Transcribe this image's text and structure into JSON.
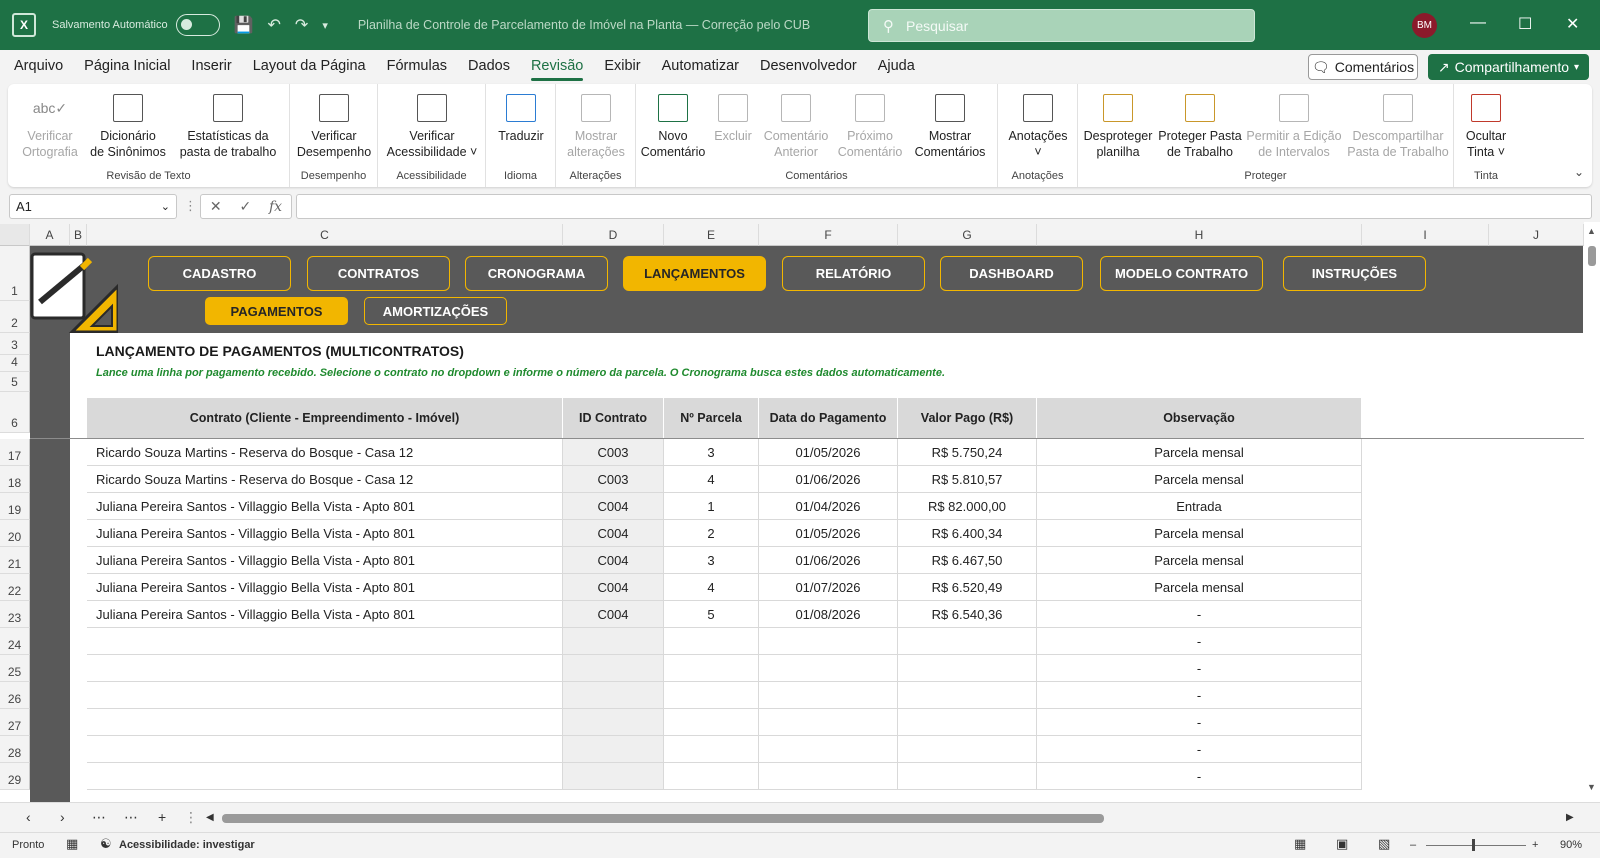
{
  "titlebar": {
    "app_icon": "excel-app-icon",
    "autosave_label": "Salvamento Automático",
    "document_title": "Planilha de Controle de Parcelamento de Imóvel na Planta — Correção pelo CUB",
    "search_placeholder": "Pesquisar",
    "avatar_initials": "BM",
    "color": "#1e7145"
  },
  "menu": {
    "items": [
      "Arquivo",
      "Página Inicial",
      "Inserir",
      "Layout da Página",
      "Fórmulas",
      "Dados",
      "Revisão",
      "Exibir",
      "Automatizar",
      "Desenvolvedor",
      "Ajuda"
    ],
    "active": "Revisão",
    "comments_label": "Comentários",
    "share_label": "Compartilhamento"
  },
  "ribbon": {
    "groups": [
      {
        "label": "Revisão de Texto",
        "buttons": [
          {
            "l1": "Verificar",
            "l2": "Ortografia",
            "disabled": true
          },
          {
            "l1": "Dicionário",
            "l2": "de Sinônimos",
            "disabled": false
          },
          {
            "l1": "Estatísticas da",
            "l2": "pasta de trabalho",
            "disabled": false
          }
        ]
      },
      {
        "label": "Desempenho",
        "buttons": [
          {
            "l1": "Verificar",
            "l2": "Desempenho",
            "disabled": false
          }
        ]
      },
      {
        "label": "Acessibilidade",
        "buttons": [
          {
            "l1": "Verificar",
            "l2": "Acessibilidade ˅",
            "disabled": false
          }
        ]
      },
      {
        "label": "Idioma",
        "buttons": [
          {
            "l1": "Traduzir",
            "l2": "",
            "disabled": false
          }
        ]
      },
      {
        "label": "Alterações",
        "buttons": [
          {
            "l1": "Mostrar",
            "l2": "alterações",
            "disabled": true
          }
        ]
      },
      {
        "label": "Comentários",
        "buttons": [
          {
            "l1": "Novo",
            "l2": "Comentário",
            "disabled": false
          },
          {
            "l1": "Excluir",
            "l2": "",
            "disabled": true
          },
          {
            "l1": "Comentário",
            "l2": "Anterior",
            "disabled": true
          },
          {
            "l1": "Próximo",
            "l2": "Comentário",
            "disabled": true
          },
          {
            "l1": "Mostrar",
            "l2": "Comentários",
            "disabled": false
          }
        ]
      },
      {
        "label": "Anotações",
        "buttons": [
          {
            "l1": "Anotações",
            "l2": "˅",
            "disabled": false
          }
        ]
      },
      {
        "label": "Proteger",
        "buttons": [
          {
            "l1": "Desproteger",
            "l2": "planilha",
            "disabled": false
          },
          {
            "l1": "Proteger Pasta",
            "l2": "de Trabalho",
            "disabled": false
          },
          {
            "l1": "Permitir a Edição",
            "l2": "de Intervalos",
            "disabled": true
          },
          {
            "l1": "Descompartilhar",
            "l2": "Pasta de Trabalho",
            "disabled": true
          }
        ]
      },
      {
        "label": "Tinta",
        "buttons": [
          {
            "l1": "Ocultar",
            "l2": "Tinta ˅",
            "disabled": false
          }
        ]
      }
    ]
  },
  "formula_bar": {
    "name_box": "A1",
    "fx_label": "fx",
    "formula": ""
  },
  "columns": [
    "A",
    "B",
    "C",
    "D",
    "E",
    "F",
    "G",
    "H",
    "I",
    "J"
  ],
  "nav_buttons": [
    "CADASTRO",
    "CONTRATOS",
    "CRONOGRAMA",
    "LANÇAMENTOS",
    "RELATÓRIO",
    "DASHBOARD",
    "MODELO CONTRATO",
    "INSTRUÇÕES"
  ],
  "nav_active": "LANÇAMENTOS",
  "sub_buttons": [
    "PAGAMENTOS",
    "AMORTIZAÇÕES"
  ],
  "sub_active": "PAGAMENTOS",
  "sheet": {
    "title": "LANÇAMENTO DE PAGAMENTOS (MULTICONTRATOS)",
    "subtitle": "Lance uma linha por pagamento recebido. Selecione o contrato no dropdown e informe o número da parcela. O Cronograma busca estes dados automaticamente.",
    "accent": "#f2b600",
    "band_color": "#595959"
  },
  "table": {
    "headers": [
      "Contrato (Cliente - Empreendimento - Imóvel)",
      "ID Contrato",
      "Nº Parcela",
      "Data do Pagamento",
      "Valor Pago (R$)",
      "Observação"
    ],
    "rows": [
      {
        "row": "17",
        "contrato": "Ricardo Souza Martins - Reserva do Bosque - Casa 12",
        "id": "C003",
        "parcela": "3",
        "data": "01/05/2026",
        "valor": "R$ 5.750,24",
        "obs": "Parcela mensal"
      },
      {
        "row": "18",
        "contrato": "Ricardo Souza Martins - Reserva do Bosque - Casa 12",
        "id": "C003",
        "parcela": "4",
        "data": "01/06/2026",
        "valor": "R$ 5.810,57",
        "obs": "Parcela mensal"
      },
      {
        "row": "19",
        "contrato": "Juliana Pereira Santos - Villaggio Bella Vista - Apto 801",
        "id": "C004",
        "parcela": "1",
        "data": "01/04/2026",
        "valor": "R$ 82.000,00",
        "obs": "Entrada"
      },
      {
        "row": "20",
        "contrato": "Juliana Pereira Santos - Villaggio Bella Vista - Apto 801",
        "id": "C004",
        "parcela": "2",
        "data": "01/05/2026",
        "valor": "R$ 6.400,34",
        "obs": "Parcela mensal"
      },
      {
        "row": "21",
        "contrato": "Juliana Pereira Santos - Villaggio Bella Vista - Apto 801",
        "id": "C004",
        "parcela": "3",
        "data": "01/06/2026",
        "valor": "R$ 6.467,50",
        "obs": "Parcela mensal"
      },
      {
        "row": "22",
        "contrato": "Juliana Pereira Santos - Villaggio Bella Vista - Apto 801",
        "id": "C004",
        "parcela": "4",
        "data": "01/07/2026",
        "valor": "R$ 6.520,49",
        "obs": "Parcela mensal"
      },
      {
        "row": "23",
        "contrato": "Juliana Pereira Santos - Villaggio Bella Vista - Apto 801",
        "id": "C004",
        "parcela": "5",
        "data": "01/08/2026",
        "valor": "R$ 6.540,36",
        "obs": "-"
      },
      {
        "row": "24",
        "contrato": "",
        "id": "",
        "parcela": "",
        "data": "",
        "valor": "",
        "obs": "-"
      },
      {
        "row": "25",
        "contrato": "",
        "id": "",
        "parcela": "",
        "data": "",
        "valor": "",
        "obs": "-"
      },
      {
        "row": "26",
        "contrato": "",
        "id": "",
        "parcela": "",
        "data": "",
        "valor": "",
        "obs": "-"
      },
      {
        "row": "27",
        "contrato": "",
        "id": "",
        "parcela": "",
        "data": "",
        "valor": "",
        "obs": "-"
      },
      {
        "row": "28",
        "contrato": "",
        "id": "",
        "parcela": "",
        "data": "",
        "valor": "",
        "obs": "-"
      },
      {
        "row": "29",
        "contrato": "",
        "id": "",
        "parcela": "",
        "data": "",
        "valor": "",
        "obs": "-"
      }
    ]
  },
  "row_headers_top": [
    "1",
    "2",
    "3",
    "4",
    "5",
    "6"
  ],
  "status": {
    "ready": "Pronto",
    "accessibility": "Acessibilidade: investigar",
    "zoom": "90%"
  }
}
